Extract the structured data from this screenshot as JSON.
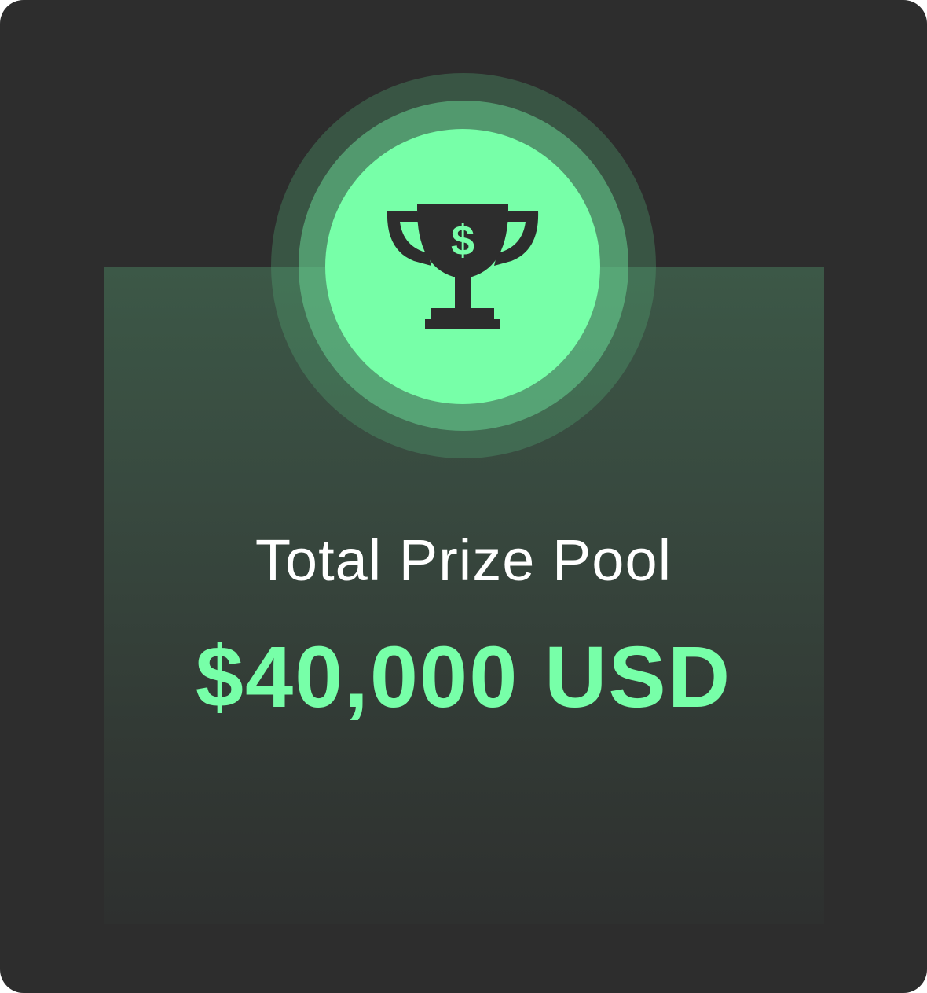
{
  "card": {
    "icon": "trophy-dollar-icon",
    "currency_symbol": "$",
    "title": "Total Prize Pool",
    "amount": "$40,000 USD"
  },
  "colors": {
    "background": "#2d2d2d",
    "accent": "#77ffa8",
    "title_text": "#ffffff",
    "trophy": "#2d2d2d"
  }
}
